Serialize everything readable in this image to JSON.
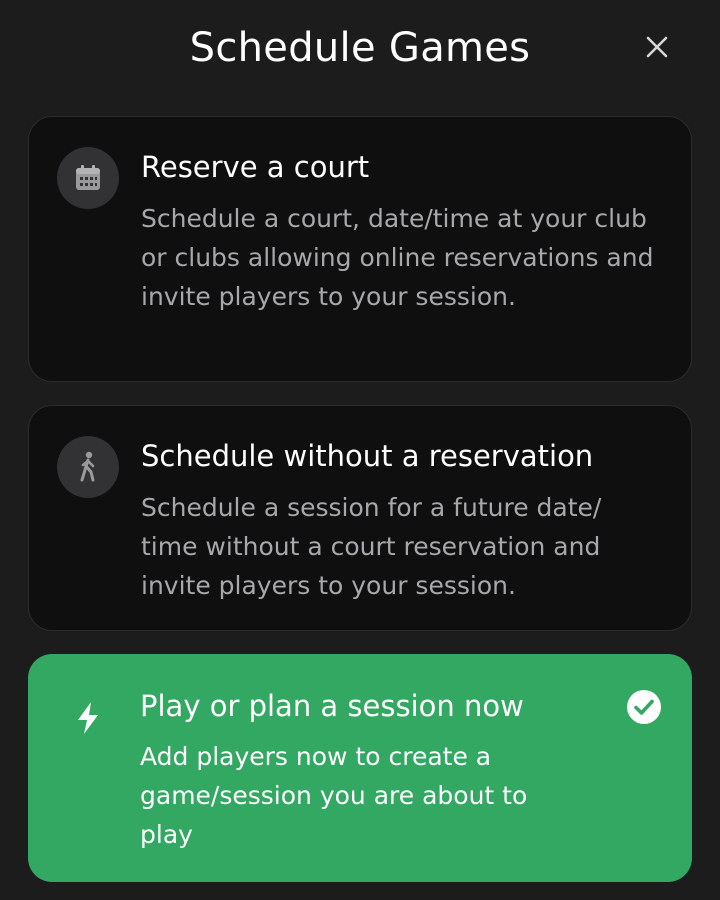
{
  "header": {
    "title": "Schedule Games",
    "close_icon": "close-icon"
  },
  "options": [
    {
      "icon": "calendar-icon",
      "title": "Reserve a court",
      "description": "Schedule a court, date/time at your club or clubs allowing online reservations and invite players to your session.",
      "selected": false
    },
    {
      "icon": "walking-person-icon",
      "title": "Schedule without a reservation",
      "description": "Schedule a session for a future date/ time without a court reservation and invite players to your session.",
      "selected": false
    },
    {
      "icon": "lightning-bolt-icon",
      "title": "Play or plan a session now",
      "description": "Add players now to create a game/session you are about to play",
      "selected": true,
      "selected_icon": "check-circle-icon"
    }
  ],
  "colors": {
    "background": "#1c1c1d",
    "card": "#0f0f10",
    "selected_card": "#33a863",
    "description_text": "#a8a8aa",
    "icon_circle": "#323234"
  }
}
